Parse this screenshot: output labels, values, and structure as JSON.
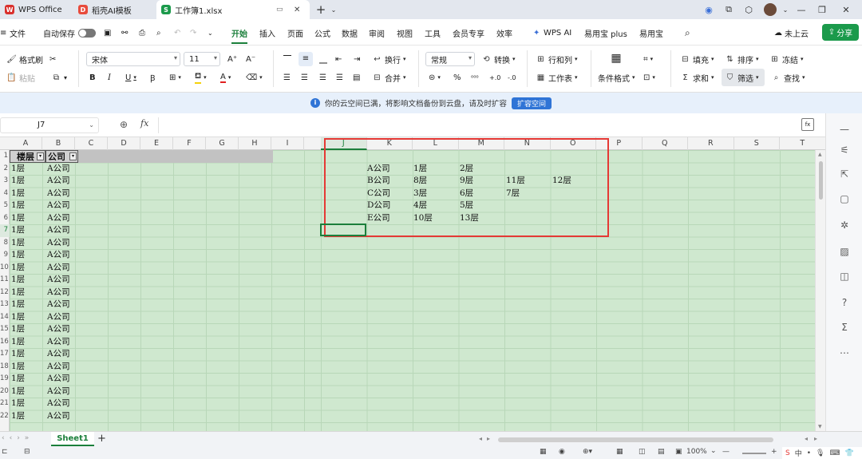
{
  "titlebar": {
    "tabs": [
      {
        "label": "WPS Office"
      },
      {
        "label": "稻壳AI模板"
      },
      {
        "label": "工作簿1.xlsx"
      }
    ],
    "add_tab": "+"
  },
  "menubar": {
    "file": "文件",
    "autosave": "自动保存",
    "items": [
      "开始",
      "插入",
      "页面",
      "公式",
      "数据",
      "审阅",
      "视图",
      "工具",
      "会员专享",
      "效率",
      "WPS AI",
      "易用宝 plus",
      "易用宝"
    ],
    "cloud": "未上云",
    "share": "分享"
  },
  "ribbon": {
    "format_painter": "格式刷",
    "paste": "粘贴",
    "font_name": "宋体",
    "font_size": "11",
    "wrap": "换行",
    "merge": "合并",
    "number_format": "常规",
    "convert": "转换",
    "row_col": "行和列",
    "worksheet": "工作表",
    "cond_format": "条件格式",
    "fill": "填充",
    "sort": "排序",
    "freeze": "冻结",
    "sum": "求和",
    "filter": "筛选",
    "find": "查找"
  },
  "notice": {
    "text": "你的云空间已满，将影响文档备份到云盘，请及时扩容",
    "button": "扩容空间"
  },
  "formula_bar": {
    "cell_ref": "J7",
    "fx": "fx"
  },
  "grid": {
    "left_columns": [
      "A",
      "B",
      "C",
      "D",
      "E",
      "F",
      "G",
      "H",
      "I"
    ],
    "right_columns": [
      "J",
      "K",
      "L",
      "M",
      "N",
      "O",
      "P",
      "Q",
      "R",
      "S",
      "T"
    ],
    "row_numbers": [
      "1",
      "2",
      "3",
      "4",
      "5",
      "6",
      "7",
      "8",
      "9",
      "10",
      "11",
      "12",
      "13",
      "14",
      "15",
      "16",
      "17",
      "18",
      "19",
      "20",
      "21",
      "22"
    ],
    "header_a": "楼层",
    "header_b": "公司",
    "rows_a": [
      "1层",
      "1层",
      "1层",
      "1层",
      "1层",
      "1层",
      "1层",
      "1层",
      "1层",
      "1层",
      "1层",
      "1层",
      "1层",
      "1层",
      "1层",
      "1层",
      "1层",
      "1层",
      "1层",
      "1层",
      "1层",
      "1层"
    ],
    "rows_b": [
      "A公司",
      "A公司",
      "A公司",
      "A公司",
      "A公司",
      "A公司",
      "A公司",
      "A公司",
      "A公司",
      "A公司",
      "A公司",
      "A公司",
      "A公司",
      "A公司",
      "A公司",
      "A公司",
      "A公司",
      "A公司",
      "A公司",
      "A公司",
      "A公司",
      "A公司"
    ],
    "summary": [
      [
        "A公司",
        "1层",
        "2层",
        "",
        ""
      ],
      [
        "B公司",
        "8层",
        "9层",
        "11层",
        "12层"
      ],
      [
        "C公司",
        "3层",
        "6层",
        "7层",
        ""
      ],
      [
        "D公司",
        "4层",
        "5层",
        "",
        ""
      ],
      [
        "E公司",
        "10层",
        "13层",
        "",
        ""
      ]
    ],
    "highlight_color": "#e53935",
    "sheet_bg": "#cfe8cf"
  },
  "sheets": {
    "active": "Sheet1",
    "add": "+"
  },
  "status": {
    "zoom": "100%",
    "ime": "中"
  }
}
